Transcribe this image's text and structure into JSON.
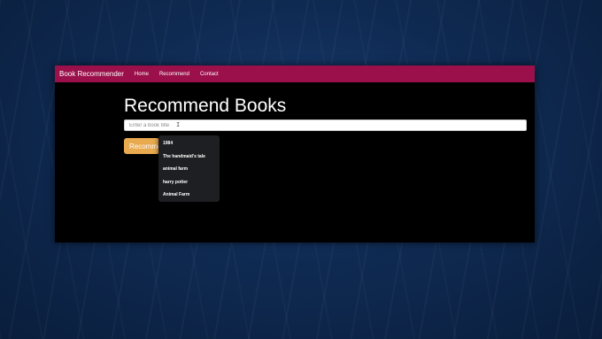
{
  "navbar": {
    "brand": "Book Recommender",
    "links": [
      "Home",
      "Recommend",
      "Contact"
    ]
  },
  "main": {
    "title": "Recommend Books",
    "search": {
      "placeholder": "Enter a book title",
      "value": ""
    },
    "button_label": "Recommend"
  },
  "autocomplete": {
    "items": [
      "1984",
      "The handmaid's tale",
      "animal farm",
      "harry potter",
      "Animal Farm"
    ]
  },
  "colors": {
    "navbar": "#9b0f4a",
    "button": "#e8a94f",
    "content_bg": "#000000",
    "dropdown_bg": "#1e1f22"
  },
  "icons": {
    "cursor": "text-cursor-icon"
  }
}
